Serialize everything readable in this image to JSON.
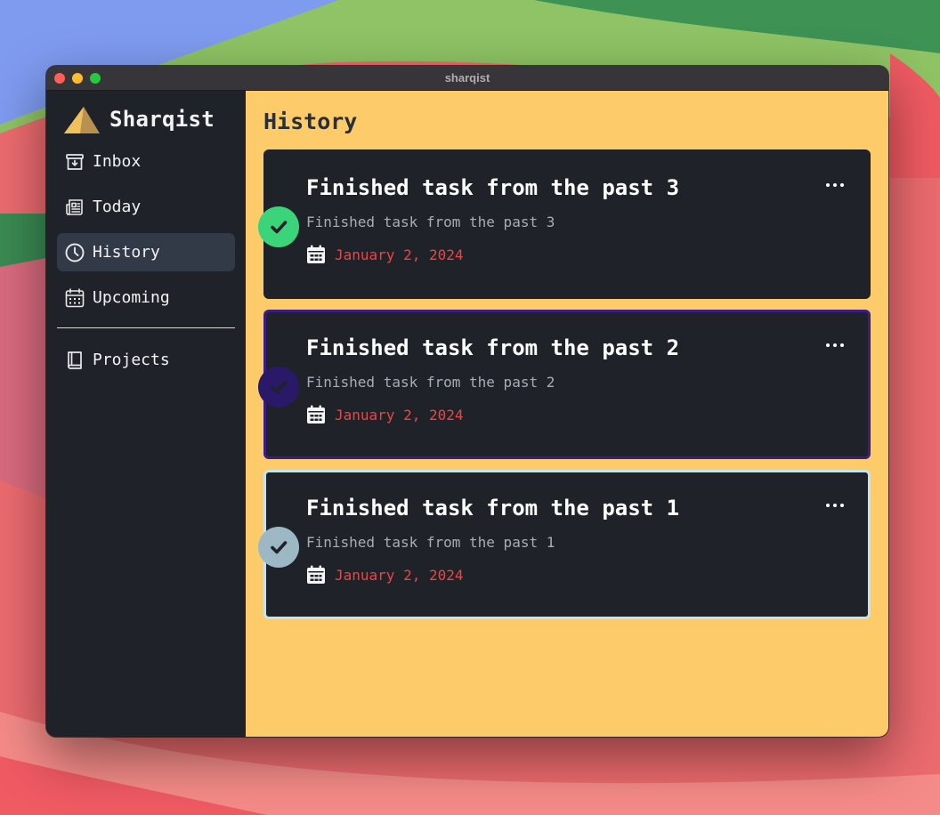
{
  "window": {
    "title": "sharqist"
  },
  "sidebar": {
    "brand": {
      "name": "Sharqist",
      "icon": "mountain-logo-icon"
    },
    "items": [
      {
        "label": "Inbox",
        "icon": "inbox-icon",
        "active": false
      },
      {
        "label": "Today",
        "icon": "newspaper-icon",
        "active": false
      },
      {
        "label": "History",
        "icon": "clock-icon",
        "active": true
      },
      {
        "label": "Upcoming",
        "icon": "calendar-grid-icon",
        "active": false
      }
    ],
    "projects": {
      "label": "Projects",
      "icon": "book-icon"
    }
  },
  "main": {
    "title": "History",
    "tasks": [
      {
        "title": "Finished task from the past 3",
        "description": "Finished task from the past 3",
        "date": "January 2, 2024",
        "check_color": "#3bd47a",
        "border_color": "#1f2329"
      },
      {
        "title": "Finished task from the past 2",
        "description": "Finished task from the past 2",
        "date": "January 2, 2024",
        "check_color": "#2a1868",
        "border_color": "#3b1c8c"
      },
      {
        "title": "Finished task from the past 1",
        "description": "Finished task from the past 1",
        "date": "January 2, 2024",
        "check_color": "#9cb8c4",
        "border_color": "#c4e3ee"
      }
    ]
  },
  "colors": {
    "sidebar_bg": "#1f2329",
    "main_bg": "#fecb6a",
    "active_nav": "#333a47",
    "date_red": "#ee4444",
    "card_bg": "#1f2329"
  }
}
